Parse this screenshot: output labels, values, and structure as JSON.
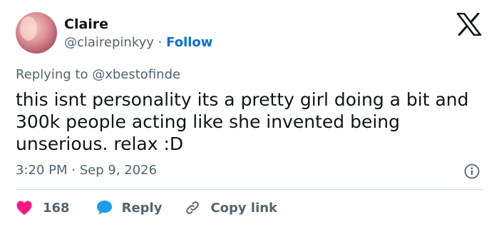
{
  "author": {
    "display_name": "Claire",
    "handle": "@clairepinkyy",
    "separator": "·",
    "follow_label": "Follow"
  },
  "reply_context": {
    "prefix": "Replying to",
    "mention": "@xbestofinde"
  },
  "tweet": {
    "text": "this isnt personality its a pretty girl doing a bit and 300k people acting like she invented being unserious. relax :D",
    "time": "3:20 PM",
    "separator": "·",
    "date": "Sep 9, 2026"
  },
  "actions": {
    "like_count": "168",
    "reply_label": "Reply",
    "copy_link_label": "Copy link"
  },
  "icons": {
    "brand": "x-logo-icon",
    "info": "info-icon",
    "like": "heart-icon",
    "reply": "speech-bubble-icon",
    "copy_link": "link-icon"
  },
  "colors": {
    "text": "#0f1419",
    "secondary": "#536471",
    "follow": "#006fd6",
    "like": "#f91880",
    "reply": "#1d9bf0",
    "divider": "#cfd9de"
  }
}
